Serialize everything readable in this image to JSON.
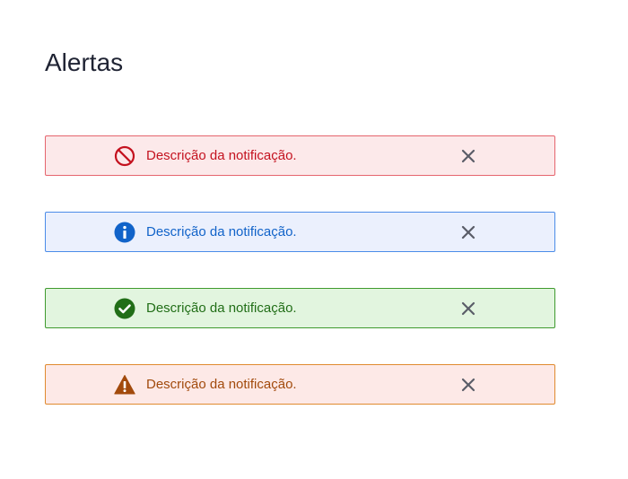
{
  "page": {
    "title": "Alertas"
  },
  "alerts": [
    {
      "type": "error",
      "message": "Descrição da notificação.",
      "icon": "prohibited-icon",
      "color": "#c4121f",
      "background": "#fce9ea",
      "border": "#e5656e"
    },
    {
      "type": "info",
      "message": "Descrição da notificação.",
      "icon": "info-icon",
      "color": "#1163c9",
      "background": "#ebf0fd",
      "border": "#4b8ce8"
    },
    {
      "type": "success",
      "message": "Descrição da notificação.",
      "icon": "checkmark-circle-icon",
      "color": "#216e17",
      "background": "#e2f5df",
      "border": "#3f9a2f"
    },
    {
      "type": "warning",
      "message": "Descrição da notificação.",
      "icon": "warning-triangle-icon",
      "color": "#a24a0c",
      "background": "#fde9e7",
      "border": "#e08a2f"
    }
  ],
  "close_icon": "close-icon",
  "close_icon_color": "#5a5d68"
}
